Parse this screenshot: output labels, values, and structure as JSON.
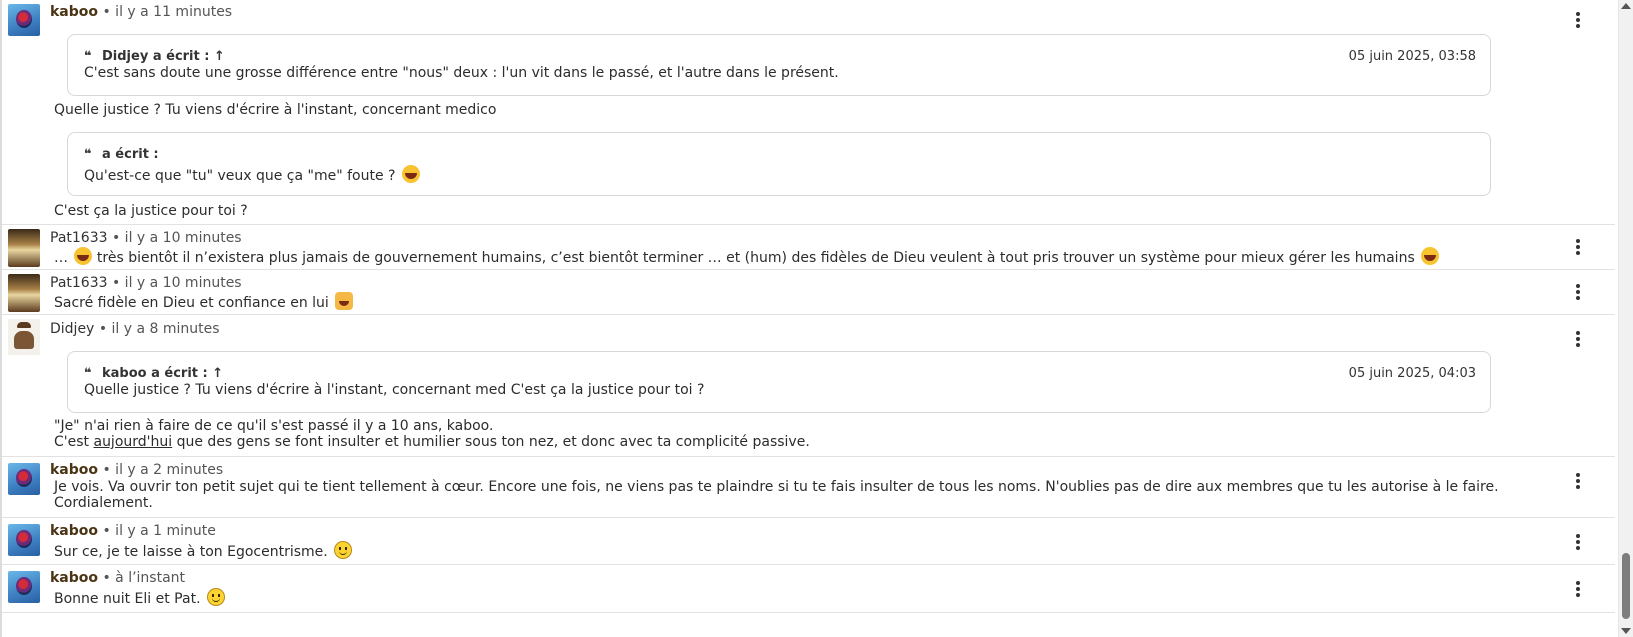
{
  "posts": [
    {
      "author": "kaboo",
      "time": "• il y a 11 minutes",
      "quote1": {
        "header": "Didjey a écrit : ↑",
        "date": "05 juin 2025, 03:58",
        "text": "C'est sans doute une grosse différence entre \"nous\" deux : l'un vit dans le passé, et l'autre dans le présent."
      },
      "line1": "Quelle justice ? Tu viens d'écrire à l'instant, concernant medico",
      "quote2": {
        "header": " a écrit :",
        "text": "Qu'est-ce que \"tu\" veux que ça \"me\" foute ?"
      },
      "line2": "C'est ça la justice pour toi ?"
    },
    {
      "author": "Pat1633",
      "time": "• il y a 10 minutes",
      "prefix": "…",
      "text": "très bientôt il n’existera plus jamais de gouvernement humains, c’est bientôt terminer … et (hum) des fidèles de Dieu veulent à tout pris trouver un système pour mieux gérer les humains"
    },
    {
      "author": "Pat1633",
      "time": "• il y a 10 minutes",
      "text": "Sacré fidèle en Dieu et confiance en lui"
    },
    {
      "author": "Didjey",
      "time": "• il y a 8 minutes",
      "quote": {
        "header": "kaboo a écrit : ↑",
        "date": "05 juin 2025, 04:03",
        "text": "Quelle justice ? Tu viens d'écrire à l'instant, concernant med C'est ça la justice pour toi ?"
      },
      "line1": "\"Je\" n'ai rien à faire de ce qu'il s'est passé il y a 10 ans, kaboo.",
      "line2_a": "C'est ",
      "line2_link": "aujourd'hui",
      "line2_b": " que des gens se font insulter et humilier sous ton nez, et donc avec ta complicité passive."
    },
    {
      "author": "kaboo",
      "time": "• il y a 2 minutes",
      "line1": "Je vois. Va ouvrir ton petit sujet qui te tient tellement à cœur. Encore une fois, ne viens pas te plaindre si tu te fais insulter de tous les noms. N'oublies pas de dire aux membres que tu les autorise à le faire.",
      "line2": "Cordialement."
    },
    {
      "author": "kaboo",
      "time": "• il y a 1 minute",
      "text": "Sur ce, je te laisse à ton Egocentrisme."
    },
    {
      "author": "kaboo",
      "time": "• à l’instant",
      "text": "Bonne nuit Eli et Pat."
    }
  ],
  "icons": {
    "quote": "quote-icon",
    "menu": "kebab-menu-icon",
    "smile": "smile-emoji-icon",
    "laugh": "laugh-emoji-icon"
  }
}
